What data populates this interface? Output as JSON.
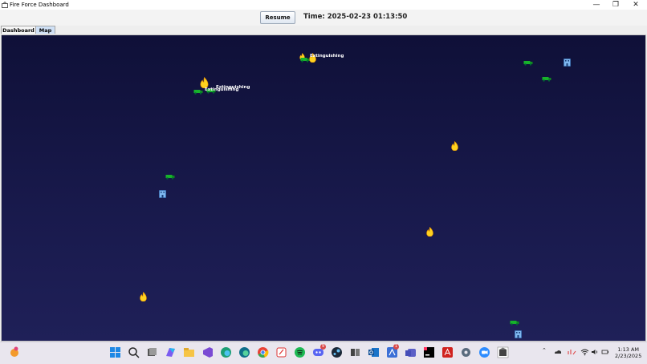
{
  "window": {
    "title": "Fire Force Dashboard",
    "minimize": "—",
    "maximize": "❐",
    "close": "✕"
  },
  "controls": {
    "resume_label": "Resume",
    "time_text": "Time: 2025-02-23 01:13:50"
  },
  "tabs": [
    {
      "label": "Dashboard"
    },
    {
      "label": "Map"
    }
  ],
  "map": {
    "labels": [
      "Extinguishing",
      "Extinguishing",
      "Extinguishing"
    ],
    "fires": 6,
    "trucks": 7,
    "stations": 3,
    "colors": {
      "background": "#13143f",
      "fire": "#ffd21f",
      "truck": "#17b22b",
      "station": "#7fb8f0"
    }
  },
  "taskbar": {
    "icons": [
      "weather-icon",
      "windows-start-icon",
      "search-icon",
      "task-view-icon",
      "copilot-icon",
      "file-explorer-icon",
      "visual-studio-icon",
      "edge-icon",
      "edge-dev-icon",
      "chrome-icon",
      "snipping-tool-icon",
      "spotify-icon",
      "discord-icon",
      "steam-icon",
      "puzzle-icon",
      "outlook-icon",
      "app-icon",
      "teams-icon",
      "intellij-icon",
      "acrobat-icon",
      "settings-icon",
      "zoom-icon",
      "java-app-icon"
    ],
    "badges": {
      "discord": "9",
      "app": "1"
    },
    "clock_time": "1:13 AM",
    "clock_date": "2/23/2025"
  }
}
